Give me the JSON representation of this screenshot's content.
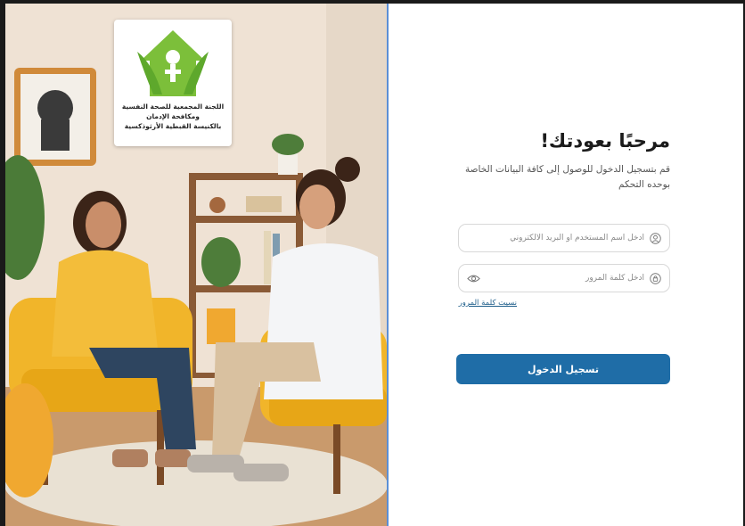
{
  "logo": {
    "line1": "اللجنة المجمعية للصحة النفسية",
    "line2": "ومكافحة الإدمان",
    "line3": "بالكنيسة القبطية الأرثوذكسية"
  },
  "login": {
    "title": "مرحبًا بعودتك!",
    "subtitle": "قم بتسجيل الدخول للوصول إلى كافة البيانات الخاصة بوحده التحكم",
    "username_placeholder": "ادخل اسم المستخدم او البريد الالكتروني",
    "password_placeholder": "ادخل كلمة المرور",
    "forgot_password": "نسيت كلمة المرور",
    "submit_label": "تسجيل الدخول"
  },
  "colors": {
    "primary_button": "#1f6da7",
    "link": "#1f5f8b",
    "logo_green": "#7cbf3a"
  },
  "icons": [
    "user-icon",
    "lock-icon",
    "eye-icon"
  ]
}
